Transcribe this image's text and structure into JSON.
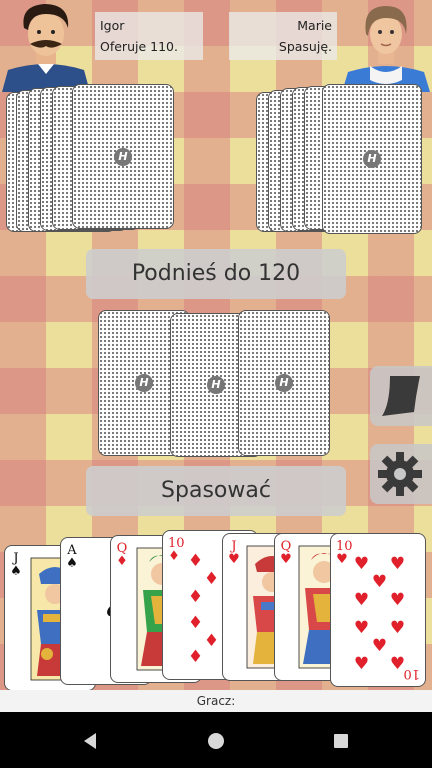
{
  "players": {
    "left": {
      "name": "Igor",
      "status": "Oferuje 110."
    },
    "right": {
      "name": "Marie",
      "status": "Spasuję."
    }
  },
  "card_back_logo": "H",
  "buttons": {
    "raise_label": "Podnieś do 120",
    "pass_label": "Spasować"
  },
  "side_buttons": {
    "chat": "chat-bubble-icon",
    "settings": "gear-icon"
  },
  "hand": [
    {
      "rank": "J",
      "suit": "♠",
      "color": "#111111",
      "suit_name": "spades"
    },
    {
      "rank": "A",
      "suit": "♠",
      "color": "#111111",
      "suit_name": "spades"
    },
    {
      "rank": "Q",
      "suit": "♦",
      "color": "#e0202a",
      "suit_name": "diamonds"
    },
    {
      "rank": "10",
      "suit": "♦",
      "color": "#e0202a",
      "suit_name": "diamonds"
    },
    {
      "rank": "J",
      "suit": "♥",
      "color": "#e0202a",
      "suit_name": "hearts"
    },
    {
      "rank": "Q",
      "suit": "♥",
      "color": "#e0202a",
      "suit_name": "hearts"
    },
    {
      "rank": "10",
      "suit": "♥",
      "color": "#e0202a",
      "suit_name": "hearts"
    }
  ],
  "footer": {
    "player_label": "Gracz:"
  },
  "colors": {
    "red_suit": "#e0202a",
    "black_suit": "#111111",
    "table_base": "#ecdf9c",
    "check_red": "#d6787d"
  }
}
